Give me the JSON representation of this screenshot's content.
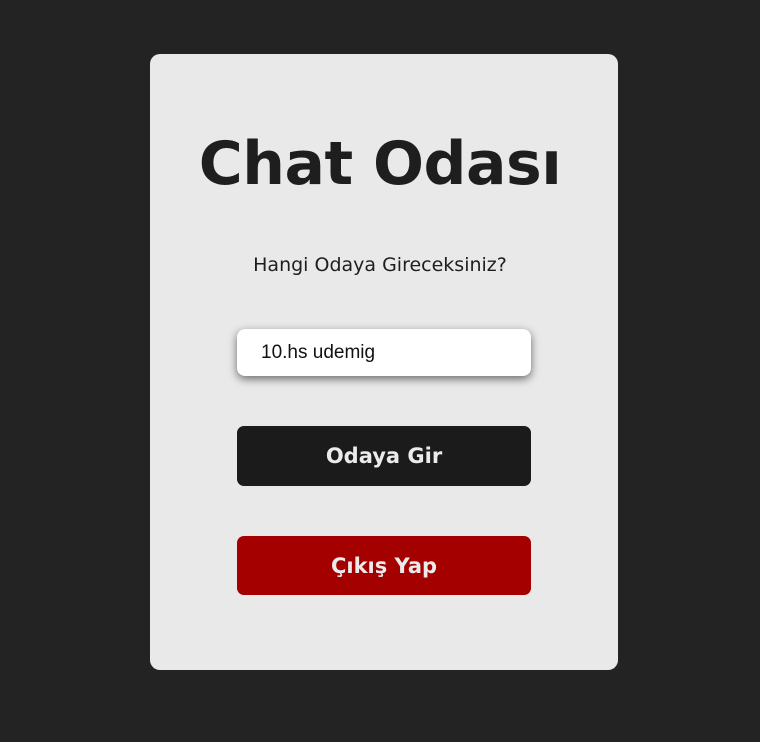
{
  "card": {
    "title": "Chat Odası",
    "question": "Hangi Odaya Gireceksiniz?",
    "room_input": {
      "value": "10.hs udemig",
      "placeholder": ""
    },
    "join_button_label": "Odaya Gir",
    "exit_button_label": "Çıkış Yap"
  },
  "colors": {
    "page_background": "#232323",
    "card_background": "#e9e9e9",
    "join_button": "#1b1b1b",
    "exit_button": "#a50000",
    "button_text": "#ebebeb",
    "heading_text": "#1e1e1e"
  }
}
